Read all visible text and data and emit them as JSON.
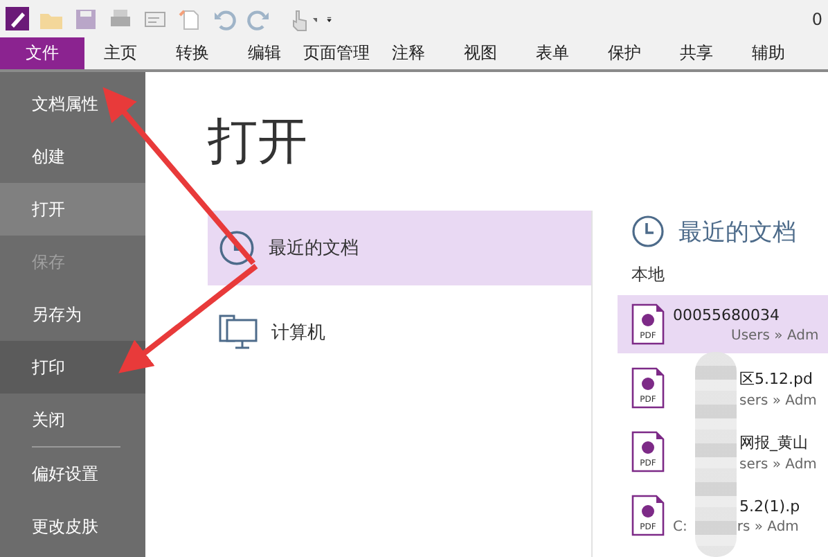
{
  "title_fragment": "0",
  "menu_tabs": [
    {
      "label": "文件",
      "selected": true
    },
    {
      "label": "主页",
      "selected": false
    },
    {
      "label": "转换",
      "selected": false
    },
    {
      "label": "编辑",
      "selected": false
    },
    {
      "label": "页面管理",
      "selected": false
    },
    {
      "label": "注释",
      "selected": false
    },
    {
      "label": "视图",
      "selected": false
    },
    {
      "label": "表单",
      "selected": false
    },
    {
      "label": "保护",
      "selected": false
    },
    {
      "label": "共享",
      "selected": false
    },
    {
      "label": "辅助",
      "selected": false
    }
  ],
  "sidebar": {
    "items": [
      {
        "label": "文档属性",
        "selected": false,
        "hovered": false,
        "disabled": false,
        "divider_after": false
      },
      {
        "label": "创建",
        "selected": false,
        "hovered": false,
        "disabled": false,
        "divider_after": false
      },
      {
        "label": "打开",
        "selected": true,
        "hovered": false,
        "disabled": false,
        "divider_after": false
      },
      {
        "label": "保存",
        "selected": false,
        "hovered": false,
        "disabled": true,
        "divider_after": false
      },
      {
        "label": "另存为",
        "selected": false,
        "hovered": false,
        "disabled": false,
        "divider_after": false
      },
      {
        "label": "打印",
        "selected": false,
        "hovered": true,
        "disabled": false,
        "divider_after": false
      },
      {
        "label": "关闭",
        "selected": false,
        "hovered": false,
        "disabled": false,
        "divider_after": true
      },
      {
        "label": "偏好设置",
        "selected": false,
        "hovered": false,
        "disabled": false,
        "divider_after": false
      },
      {
        "label": "更改皮肤",
        "selected": false,
        "hovered": false,
        "disabled": false,
        "divider_after": false
      }
    ]
  },
  "page_title": "打开",
  "places": [
    {
      "kind": "recent",
      "label": "最近的文档",
      "selected": true
    },
    {
      "kind": "computer",
      "label": "计算机",
      "selected": false
    }
  ],
  "recent": {
    "heading": "最近的文档",
    "group": "本地",
    "files": [
      {
        "icon_label": "PDF",
        "name": "00055680034",
        "path": "Users » Adm",
        "selected": true
      },
      {
        "icon_label": "PDF",
        "name": "区5.12.pd",
        "path": "sers » Adm",
        "selected": false
      },
      {
        "icon_label": "PDF",
        "name": "网报_黄山",
        "path": "sers » Adm",
        "selected": false
      },
      {
        "icon_label": "PDF",
        "name": "5.2(1).p",
        "drive": "C:",
        "path": "rs » Adm",
        "selected": false
      }
    ]
  }
}
